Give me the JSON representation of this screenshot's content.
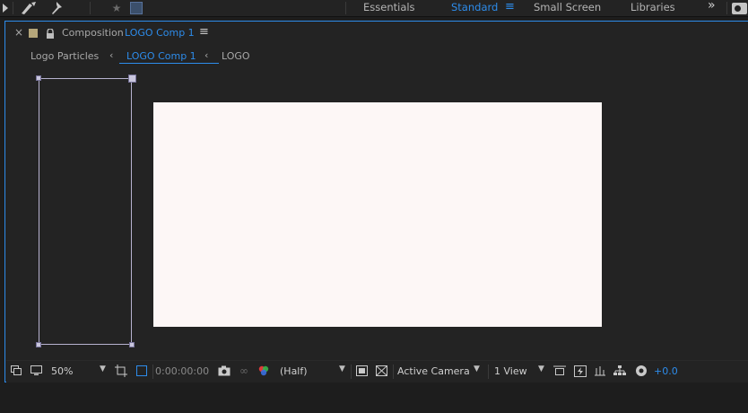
{
  "toolbar": {
    "workspaces": [
      {
        "label": "Essentials",
        "active": false
      },
      {
        "label": "Standard",
        "active": true
      },
      {
        "label": "Small Screen",
        "active": false
      },
      {
        "label": "Libraries",
        "active": false
      }
    ],
    "more_glyph": "»",
    "workspace_menu_glyph": "≡"
  },
  "panel": {
    "close_glyph": "×",
    "tab_prefix": "Composition",
    "tab_name": "LOGO Comp 1",
    "menu_glyph": "≡",
    "breadcrumbs": [
      {
        "label": "Logo Particles",
        "active": false
      },
      {
        "label": "LOGO Comp 1",
        "active": true
      },
      {
        "label": "LOGO",
        "active": false
      }
    ],
    "breadcrumb_sep": "‹"
  },
  "viewer": {
    "background_color": "#232323",
    "comp_color": "#fdf7f6"
  },
  "bottombar": {
    "zoom": "50%",
    "timecode": "0:00:00:00",
    "resolution": "(Half)",
    "camera": "Active Camera",
    "views": "1 View",
    "exposure": "+0.0"
  },
  "colors": {
    "accent": "#2d8ceb",
    "panel_bg": "#232323"
  }
}
